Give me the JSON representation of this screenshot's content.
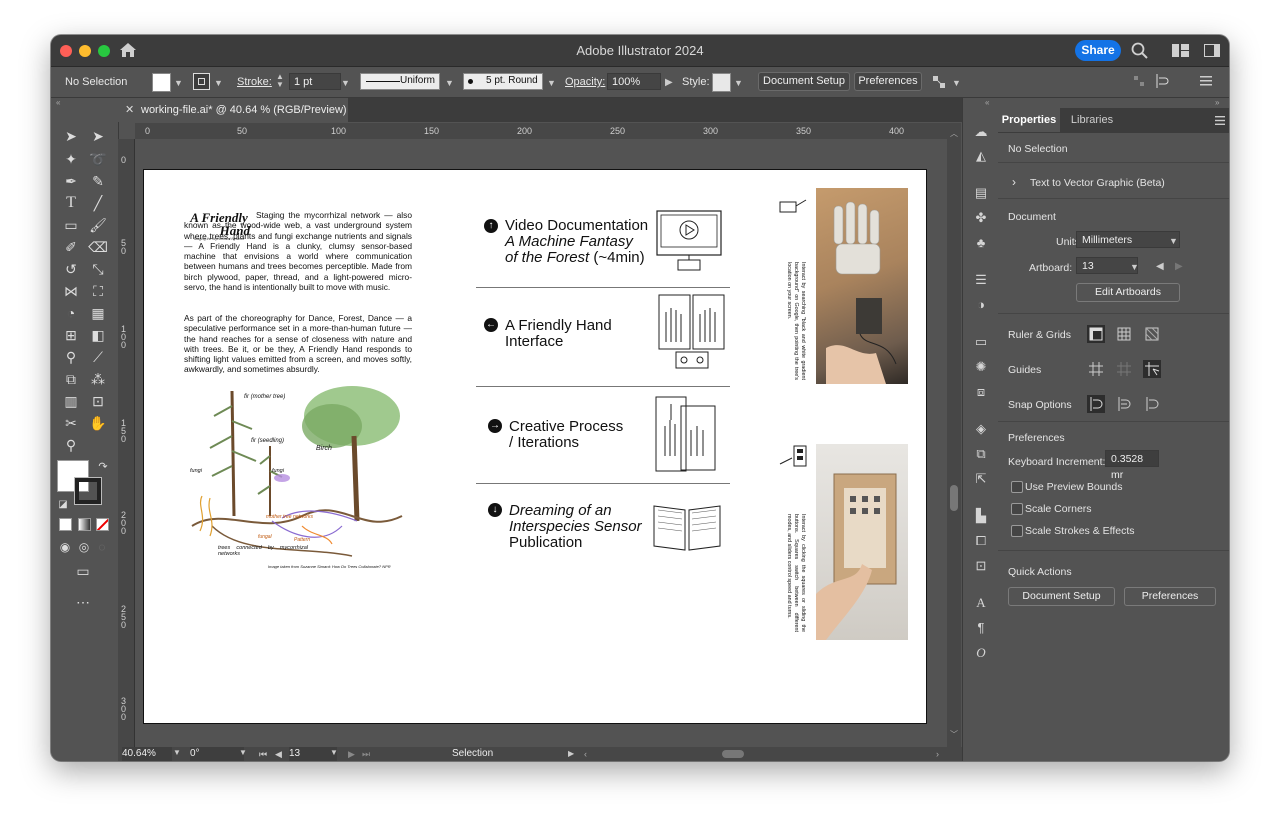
{
  "window": {
    "title": "Adobe Illustrator 2024",
    "share_label": "Share"
  },
  "control_bar": {
    "selection": "No Selection",
    "stroke_label": "Stroke:",
    "stroke_value": "1 pt",
    "uniform_label": "Uniform",
    "brush_label": "5 pt. Round",
    "opacity_label": "Opacity:",
    "opacity_value": "100%",
    "style_label": "Style:",
    "document_setup": "Document Setup",
    "preferences": "Preferences"
  },
  "document_tab": {
    "label": "working-file.ai* @ 40.64 % (RGB/Preview)"
  },
  "rulers": {
    "horizontal": [
      "0",
      "50",
      "100",
      "150",
      "200",
      "250",
      "300",
      "350",
      "400"
    ],
    "vertical": [
      "0",
      "50",
      "100",
      "150",
      "200",
      "250",
      "300"
    ]
  },
  "status_bar": {
    "zoom": "40.64%",
    "rotation": "0°",
    "artboard": "13",
    "tool": "Selection"
  },
  "artboard_content": {
    "logo_line1": "A Friendly",
    "logo_line2": "Hand",
    "logo_sub": "Staging the Mycorrhizal Network",
    "paragraph1": "Staging the mycorrhizal network — also known as the wood-wide web, a vast underground system where trees, plants and fungi exchange nutrients and signals — A Friendly Hand is a clunky, clumsy sensor-based machine that envisions a world where communication between humans and trees becomes perceptible. Made from birch plywood, paper, thread, and a light-powered micro-servo, the hand is intentionally built to move with music.",
    "paragraph2": "As part of the choreography for Dance, Forest, Dance — a speculative performance set in a more-than-human future —the hand reaches for a sense of closeness with nature and with trees. Be it, or be they, A Friendly Hand responds to shifting light values emitted from a screen, and moves softly, awkwardly, and sometimes absurdly.",
    "image_caption": "Image taken from Suzanne Simard: How Do Trees Collaborate? NPR",
    "sketch_labels": [
      "fir (mother tree)",
      "fir (seedling)",
      "Birch",
      "fungi",
      "fungi",
      "mother tree networks",
      "trees connected by mycorrhizal networks",
      "fungal",
      "Pattern"
    ],
    "sections": [
      {
        "arrow": "↑",
        "line1": "Video Documentation",
        "line2": "A Machine Fantasy",
        "line3": "of the Forest",
        "line3_suffix": " (~4min)"
      },
      {
        "arrow": "←",
        "line1": "A Friendly Hand",
        "line2": "Interface"
      },
      {
        "arrow": "→",
        "line1": "Creative Process",
        "line2": "/ Iterations"
      },
      {
        "arrow": "↓",
        "line1": "Dreaming of an",
        "line2": "Interspecies Sensor",
        "line3": "Publication"
      }
    ],
    "side_caption1": "Interact by searching \"black and white gradient background\" on Google, then pointing the tree's location on your screen.",
    "side_caption2": "Interact by clicking the squares or sliding the buttons. Squares switch between different modes, and sliders control speed and turns."
  },
  "properties_panel": {
    "tab_properties": "Properties",
    "tab_libraries": "Libraries",
    "selection": "No Selection",
    "text_to_vector": "Text to Vector Graphic (Beta)",
    "document_heading": "Document",
    "units_label": "Units:",
    "units_value": "Millimeters",
    "artboard_label": "Artboard:",
    "artboard_value": "13",
    "edit_artboards": "Edit Artboards",
    "ruler_grids": "Ruler & Grids",
    "guides": "Guides",
    "snap_options": "Snap Options",
    "preferences_heading": "Preferences",
    "keyboard_increment_label": "Keyboard Increment:",
    "keyboard_increment_value": "0.3528 mr",
    "use_preview_bounds": "Use Preview Bounds",
    "scale_corners": "Scale Corners",
    "scale_strokes": "Scale Strokes & Effects",
    "quick_actions": "Quick Actions",
    "qa_document_setup": "Document Setup",
    "qa_preferences": "Preferences"
  },
  "colors": {
    "accent": "#1473e6",
    "panel": "#535353",
    "titlebar": "#3c3c3c"
  }
}
